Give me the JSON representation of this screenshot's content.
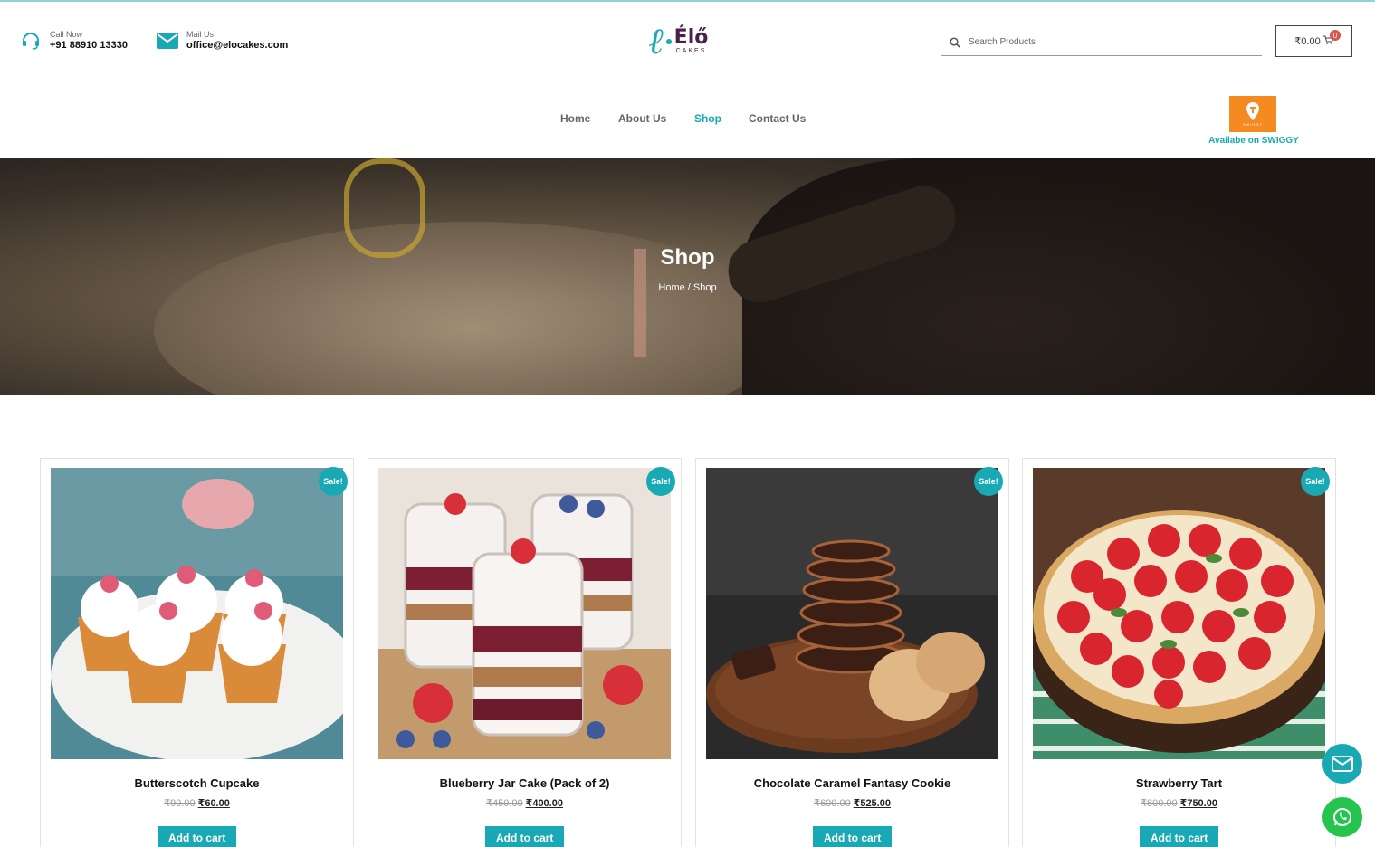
{
  "header": {
    "call_label": "Call Now",
    "call_value": "+91 88910 13330",
    "mail_label": "Mail Us",
    "mail_value": "office@elocakes.com",
    "logo_name": "Élő",
    "logo_sub": "CAKES",
    "search_placeholder": "Search Products",
    "cart_total": "₹0.00",
    "cart_count": "0"
  },
  "nav": {
    "items": [
      {
        "label": "Home"
      },
      {
        "label": "About Us"
      },
      {
        "label": "Shop",
        "active": true
      },
      {
        "label": "Contact Us"
      }
    ]
  },
  "swiggy": {
    "badge_text": "SWIGGY",
    "label": "Availabe on SWIGGY"
  },
  "banner": {
    "title": "Shop",
    "breadcrumb": "Home / Shop"
  },
  "products": [
    {
      "sale": "Sale!",
      "name": "Butterscotch Cupcake",
      "old_price": "₹90.00",
      "new_price": "₹60.00",
      "button": "Add to cart"
    },
    {
      "sale": "Sale!",
      "name": "Blueberry Jar Cake (Pack of 2)",
      "old_price": "₹450.00",
      "new_price": "₹400.00",
      "button": "Add to cart"
    },
    {
      "sale": "Sale!",
      "name": "Chocolate Caramel Fantasy Cookie",
      "old_price": "₹600.00",
      "new_price": "₹525.00",
      "button": "Add to cart"
    },
    {
      "sale": "Sale!",
      "name": "Strawberry Tart",
      "old_price": "₹800.00",
      "new_price": "₹750.00",
      "button": "Add to cart"
    }
  ],
  "colors": {
    "accent": "#18a9b5",
    "brand_purple": "#4a2148",
    "swiggy_orange": "#f58a21",
    "whatsapp_green": "#25c44f",
    "sale_badge": "#18a9b5"
  },
  "icons": {
    "phone": "headset-icon",
    "mail": "envelope-icon",
    "search": "search-icon",
    "cart": "cart-icon",
    "float_mail": "envelope-icon",
    "float_whatsapp": "whatsapp-icon"
  }
}
